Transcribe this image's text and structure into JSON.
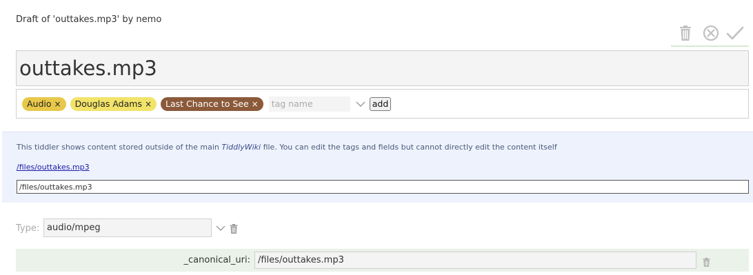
{
  "header": {
    "draft_title": "Draft of 'outtakes.mp3' by nemo"
  },
  "toolbar": {
    "buttons": [
      {
        "name": "delete",
        "icon": "trash-icon"
      },
      {
        "name": "cancel",
        "icon": "cancel-circle-icon"
      },
      {
        "name": "done",
        "icon": "checkmark-icon"
      }
    ]
  },
  "title": {
    "value": "outtakes.mp3"
  },
  "tags": {
    "items": [
      {
        "label": "Audio",
        "remove": "×",
        "bg": "#e8c84a",
        "fg": "#222222"
      },
      {
        "label": "Douglas Adams",
        "remove": "×",
        "bg": "#f2e36a",
        "fg": "#222222"
      },
      {
        "label": "Last Chance to See",
        "remove": "×",
        "bg": "#8b5a3a",
        "fg": "#ffffff"
      }
    ],
    "input_placeholder": "tag name",
    "add_label": "add"
  },
  "external_info": {
    "text_before": "This tiddler shows content stored outside of the main ",
    "text_emph": "TiddlyWiki",
    "text_after": " file. You can edit the tags and fields but cannot directly edit the content itself",
    "link_text": "/files/outtakes.mp3",
    "uri_value": "/files/outtakes.mp3"
  },
  "type": {
    "label": "Type:",
    "value": "audio/mpeg"
  },
  "fields": [
    {
      "name": "_canonical_uri:",
      "value": "/files/outtakes.mp3"
    }
  ],
  "colors": {
    "toolbar_icon": "#c0c0c0",
    "toolbar_underline": "#d6ead2",
    "info_bg": "#eef2fd",
    "field_row_bg": "#ebf2e9"
  }
}
